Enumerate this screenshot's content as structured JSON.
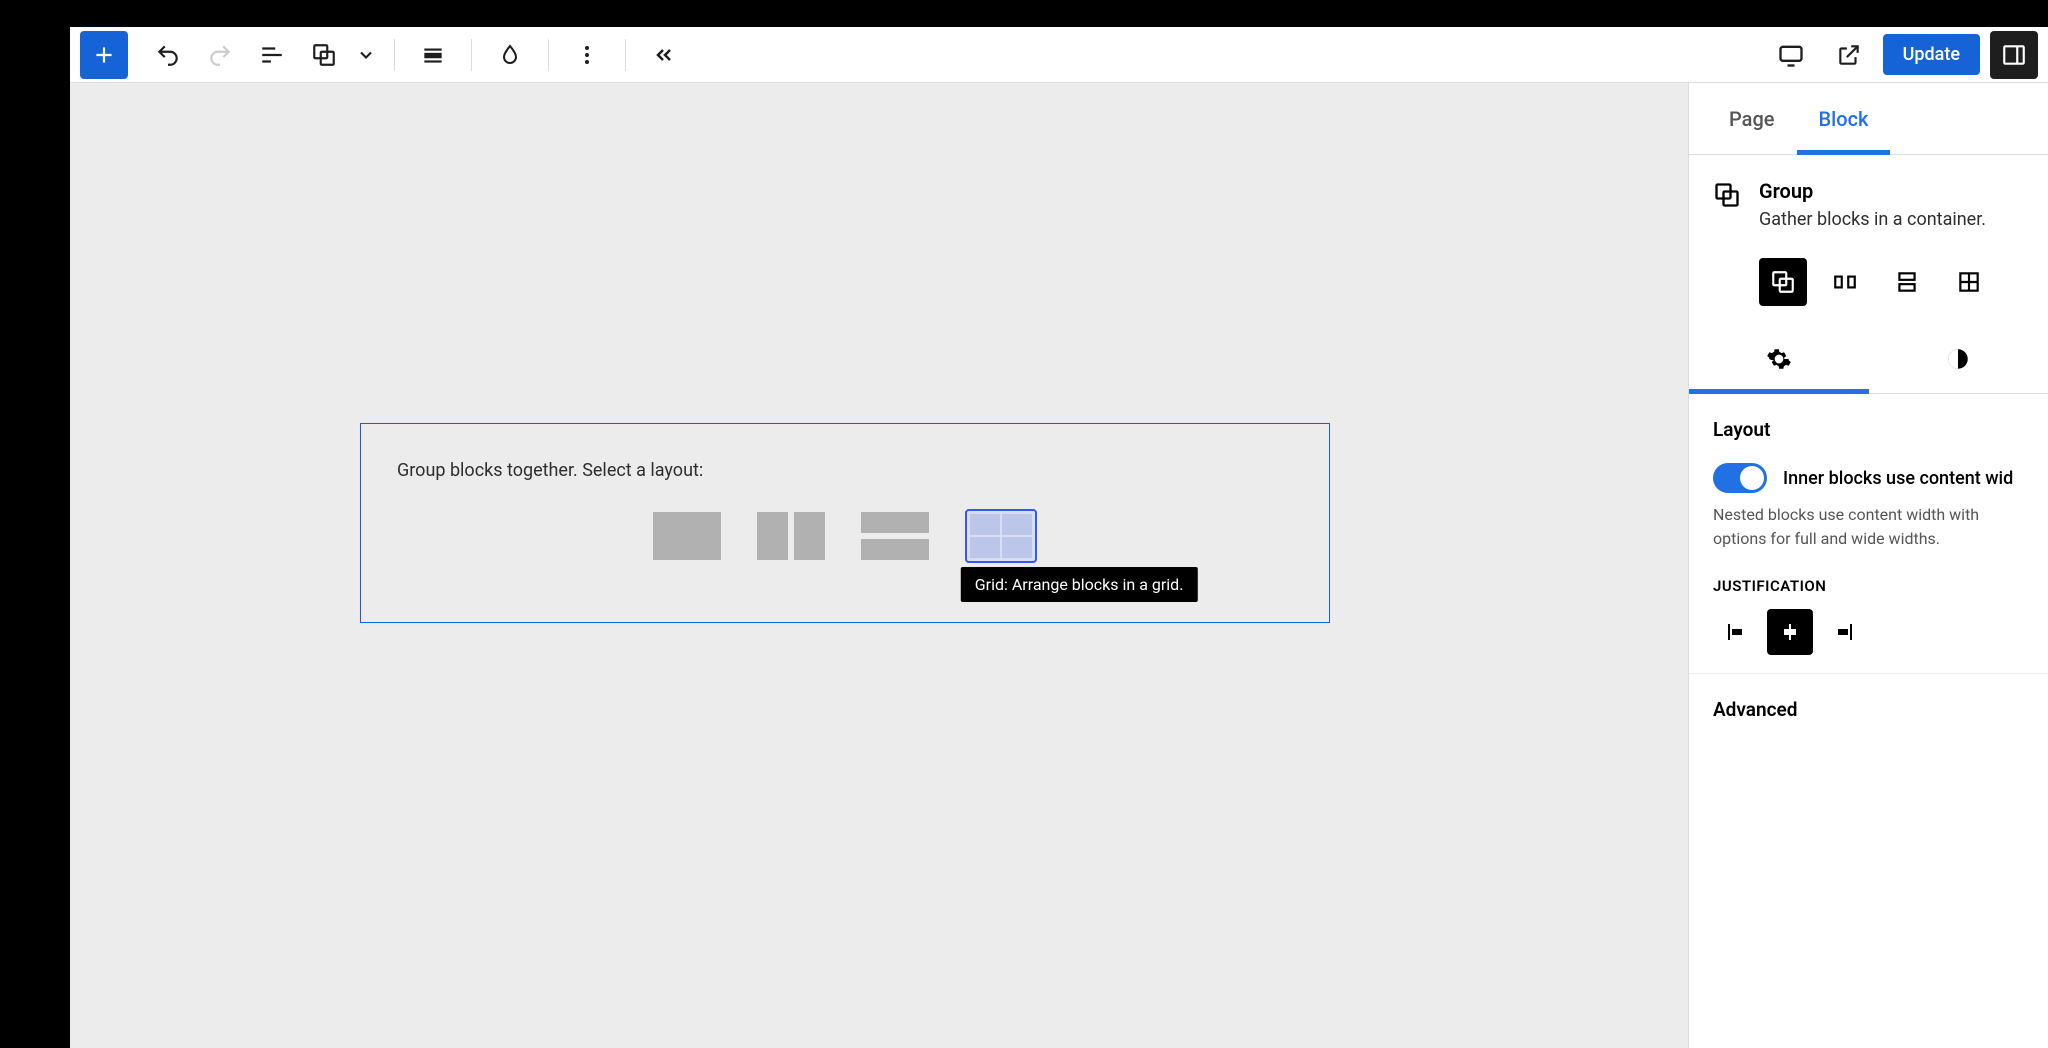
{
  "toolbar": {
    "update_label": "Update"
  },
  "sidebar": {
    "tabs": {
      "page": "Page",
      "block": "Block"
    },
    "block": {
      "name": "Group",
      "description": "Gather blocks in a container."
    },
    "layout": {
      "title": "Layout",
      "toggle_label": "Inner blocks use content wid",
      "help_text": "Nested blocks use content width with options for full and wide widths.",
      "justification_title": "Justification"
    },
    "advanced_title": "Advanced"
  },
  "canvas": {
    "group_placeholder_prompt": "Group blocks together. Select a layout:",
    "grid_tooltip": "Grid: Arrange blocks in a grid."
  }
}
